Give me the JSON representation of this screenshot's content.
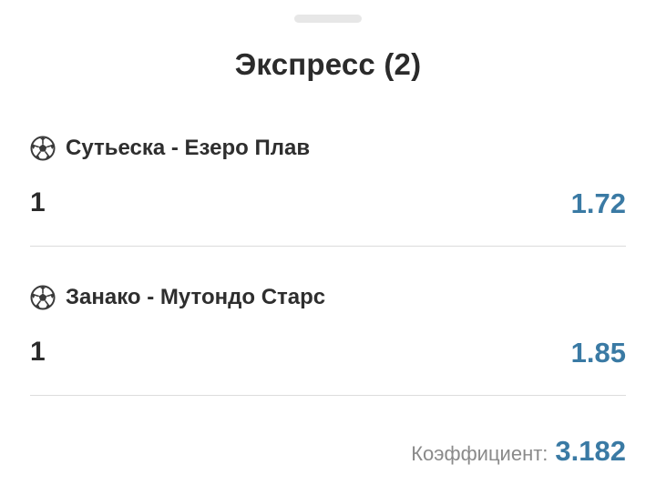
{
  "sheet": {
    "title": "Экспресс (2)"
  },
  "events": [
    {
      "icon": "soccer-ball-icon",
      "name": "Сутьеска - Езеро Плав",
      "pick": "1",
      "odd": "1.72"
    },
    {
      "icon": "soccer-ball-icon",
      "name": "Занако - Мутондо Старс",
      "pick": "1",
      "odd": "1.85"
    }
  ],
  "total": {
    "label": "Коэффициент:",
    "value": "3.182"
  },
  "colors": {
    "accent": "#3a7aa4",
    "text": "#2b2b2b",
    "muted": "#8a8a8a",
    "divider": "#dcdcdc",
    "handle": "#e7e7e7"
  }
}
